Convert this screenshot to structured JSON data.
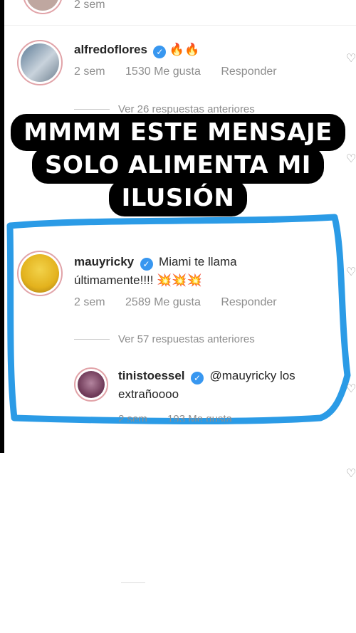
{
  "top_comment": {
    "time": "2 sem"
  },
  "comment1": {
    "username": "alfredoflores",
    "text": "🔥🔥",
    "time": "2 sem",
    "likes": "1530 Me gusta",
    "reply": "Responder",
    "view_replies": "Ver 26 respuestas anteriores"
  },
  "overlay": {
    "line1": "MMMM ESTE MENSAJE",
    "line2": "SOLO ALIMENTA MI",
    "line3": "ILUSIÓN"
  },
  "comment2": {
    "username": "mauyricky",
    "text1": "Miami te llama",
    "text2": "últimamente!!!! 💥💥💥",
    "time": "2 sem",
    "likes": "2589 Me gusta",
    "reply": "Responder",
    "view_replies": "Ver 57 respuestas anteriores"
  },
  "comment3": {
    "username": "tinistoessel",
    "text1": "@mauyricky los",
    "text2": "extrañoooo",
    "time": "2 sem",
    "likes": "193 Me gusta"
  },
  "colors": {
    "highlight": "#2b9be6",
    "verified": "#3897f0",
    "meta": "#8e8e8e"
  }
}
